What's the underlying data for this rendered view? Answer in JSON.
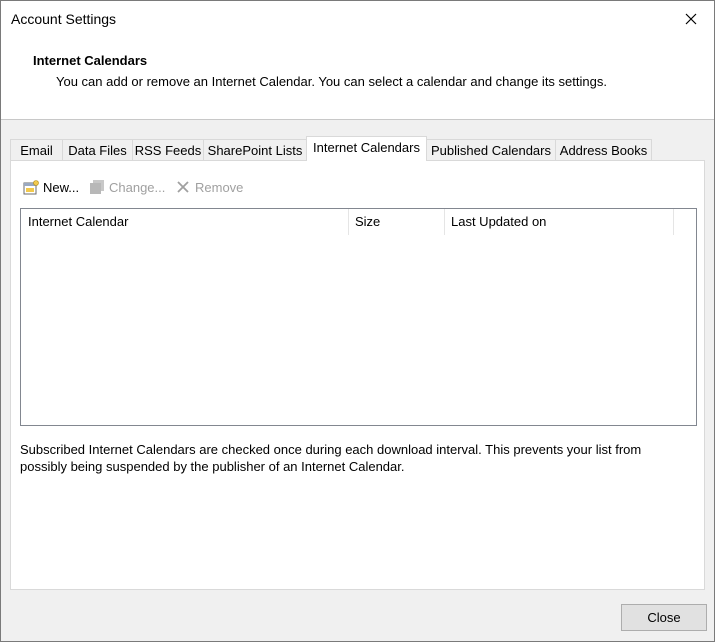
{
  "window": {
    "title": "Account Settings",
    "close_icon": "close-icon"
  },
  "header": {
    "title": "Internet Calendars",
    "description": "You can add or remove an Internet Calendar. You can select a calendar and change its settings."
  },
  "tabs": [
    {
      "label": "Email",
      "active": false
    },
    {
      "label": "Data Files",
      "active": false
    },
    {
      "label": "RSS Feeds",
      "active": false
    },
    {
      "label": "SharePoint Lists",
      "active": false
    },
    {
      "label": "Internet Calendars",
      "active": true
    },
    {
      "label": "Published Calendars",
      "active": false
    },
    {
      "label": "Address Books",
      "active": false
    }
  ],
  "toolbar": {
    "new_label": "New...",
    "change_label": "Change...",
    "remove_label": "Remove",
    "new_icon": "new-calendar-icon",
    "change_icon": "change-icon",
    "remove_icon": "remove-x-icon"
  },
  "list": {
    "columns": [
      "Internet Calendar",
      "Size",
      "Last Updated on"
    ],
    "rows": []
  },
  "note": "Subscribed Internet Calendars are checked once during each download interval. This prevents your list from possibly being suspended by the publisher of an Internet Calendar.",
  "footer": {
    "close_label": "Close"
  }
}
